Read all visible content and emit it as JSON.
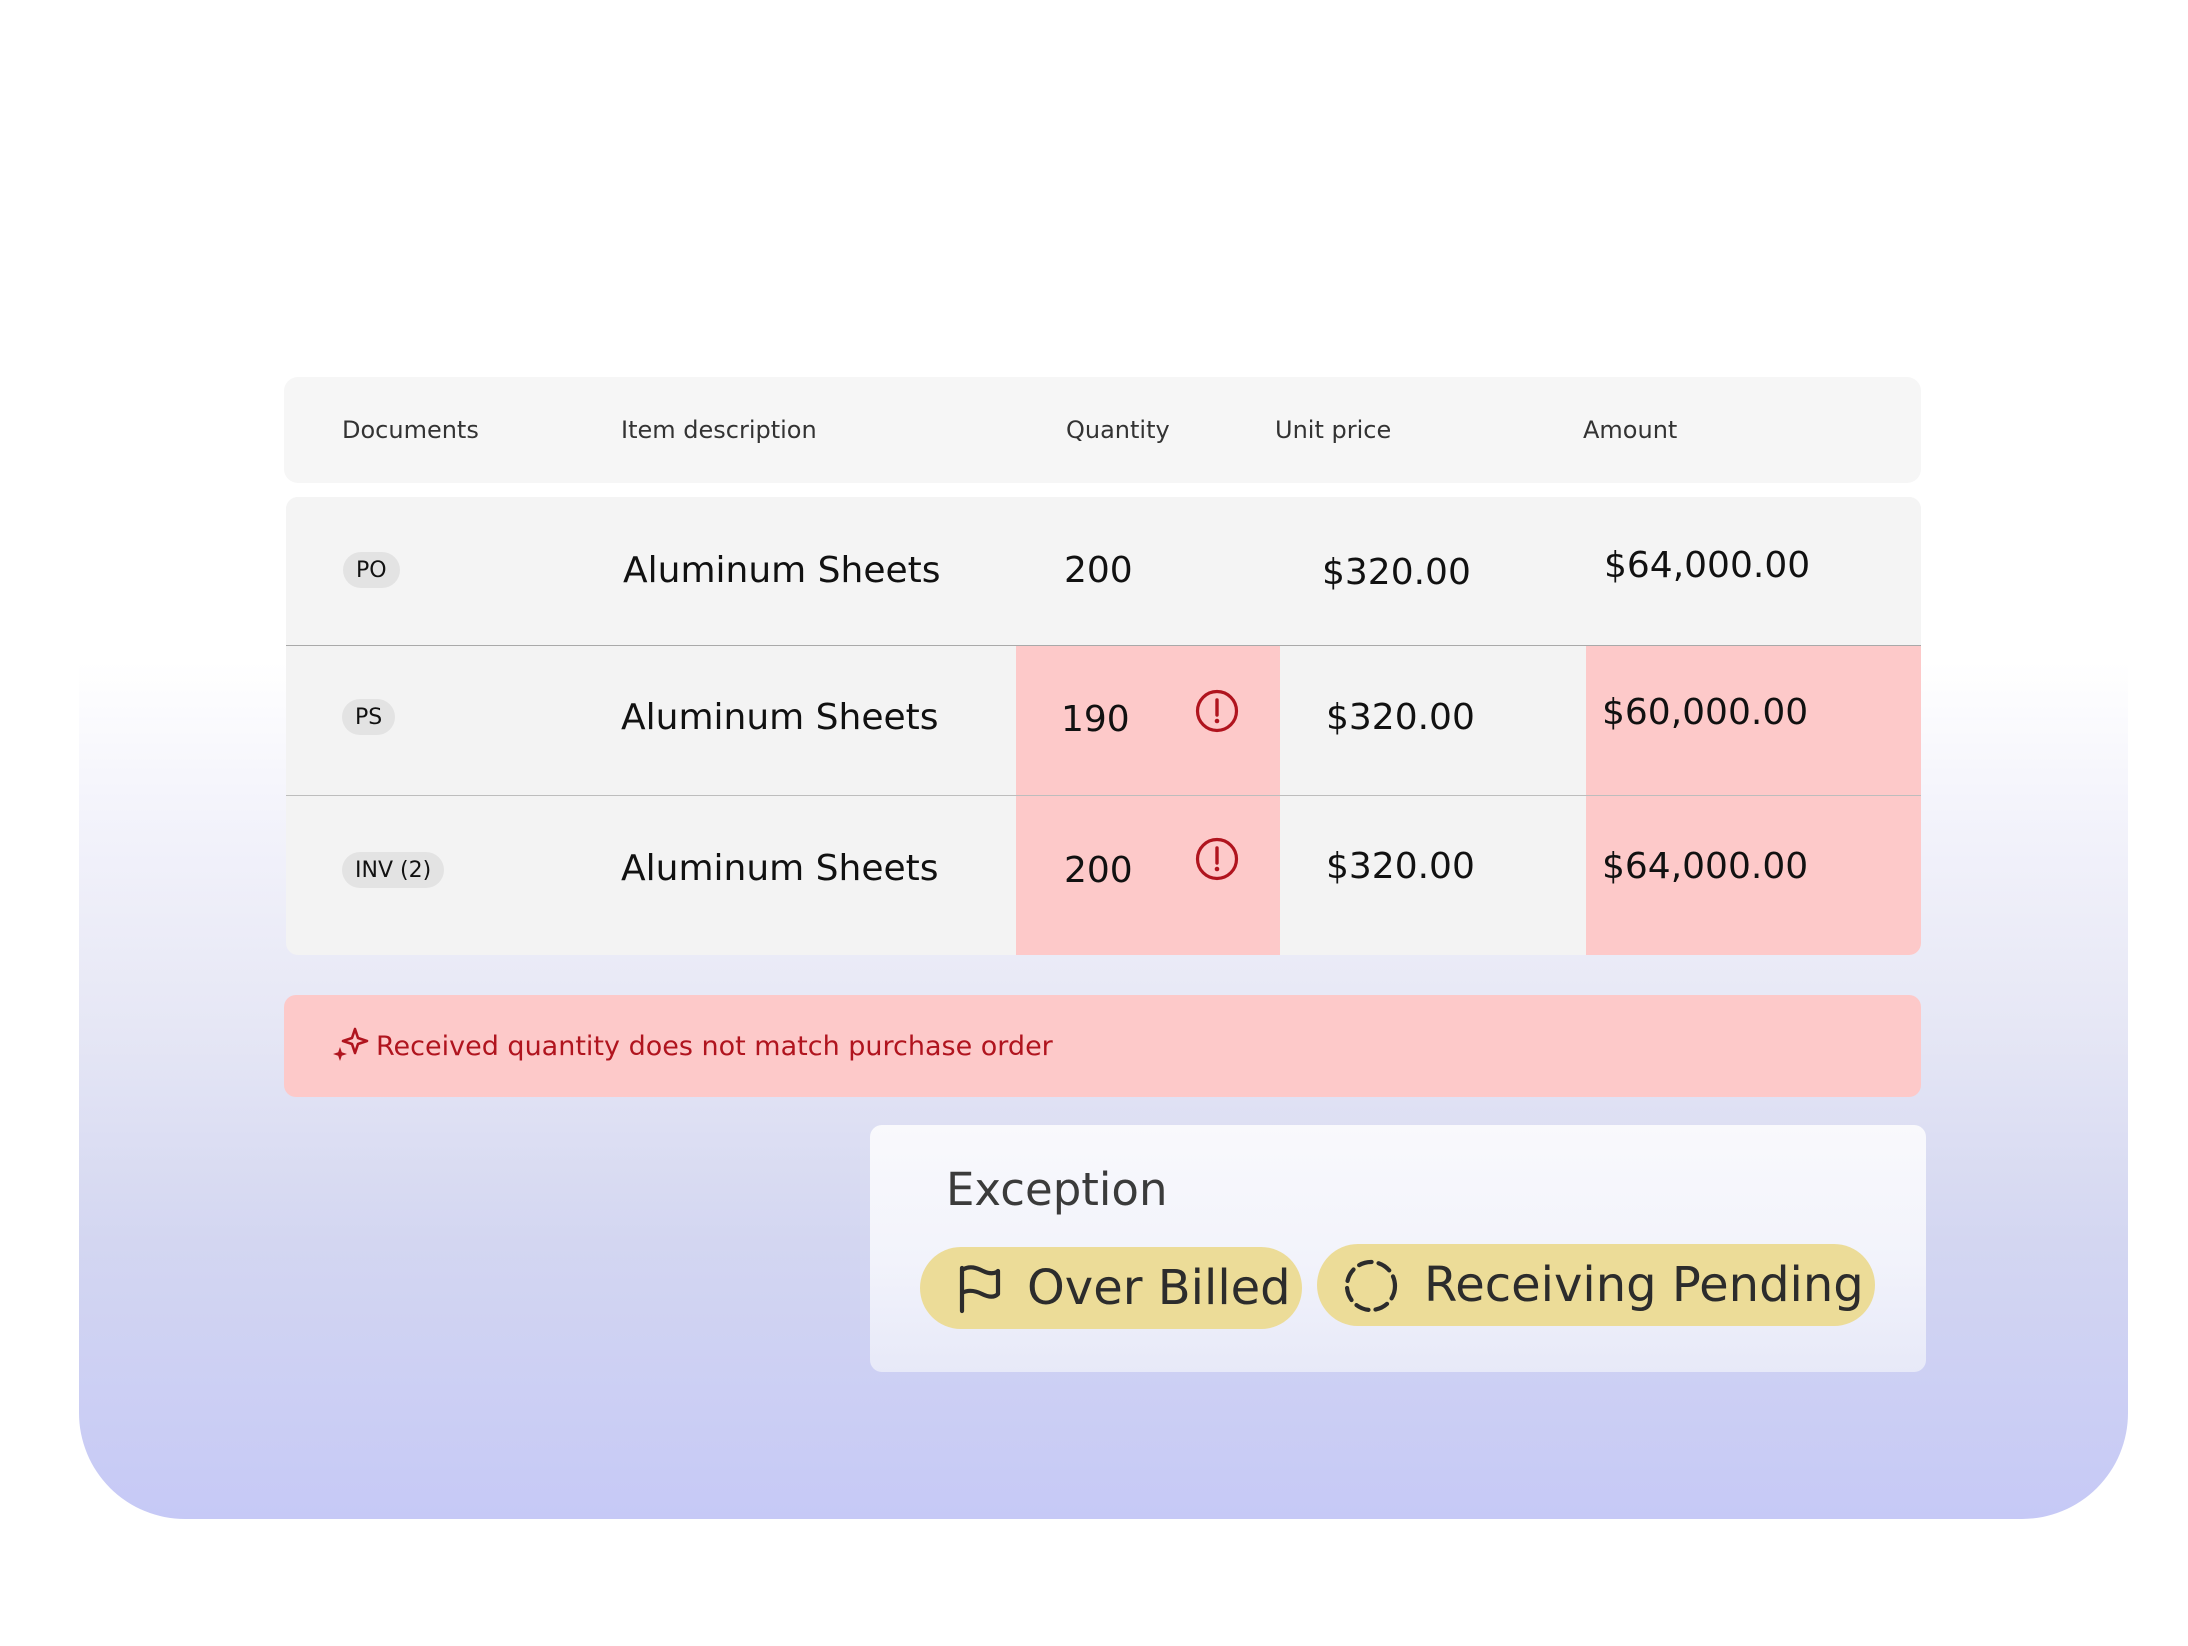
{
  "table": {
    "headers": {
      "documents": "Documents",
      "item_description": "Item description",
      "quantity": "Quantity",
      "unit_price": "Unit price",
      "amount": "Amount"
    },
    "rows": [
      {
        "document": "PO",
        "item": "Aluminum Sheets",
        "quantity": "200",
        "unit_price": "$320.00",
        "amount": "$64,000.00",
        "quantity_flag": false,
        "amount_flag": false
      },
      {
        "document": "PS",
        "item": "Aluminum Sheets",
        "quantity": "190",
        "unit_price": "$320.00",
        "amount": "$60,000.00",
        "quantity_flag": true,
        "amount_flag": true
      },
      {
        "document": "INV (2)",
        "item": "Aluminum Sheets",
        "quantity": "200",
        "unit_price": "$320.00",
        "amount": "$64,000.00",
        "quantity_flag": true,
        "amount_flag": true
      }
    ]
  },
  "alert": {
    "message": "Received quantity does not match purchase order",
    "icon": "sparkle-icon"
  },
  "exception": {
    "title": "Exception",
    "chips": [
      {
        "label": "Over Billed",
        "icon": "flag-icon"
      },
      {
        "label": "Receiving Pending",
        "icon": "dashed-circle-icon"
      }
    ]
  },
  "colors": {
    "highlight": "#fdc9c9",
    "alert_text": "#b0141e",
    "chip": "#ecdc98",
    "gradient_bottom": "#c6c9f6"
  }
}
